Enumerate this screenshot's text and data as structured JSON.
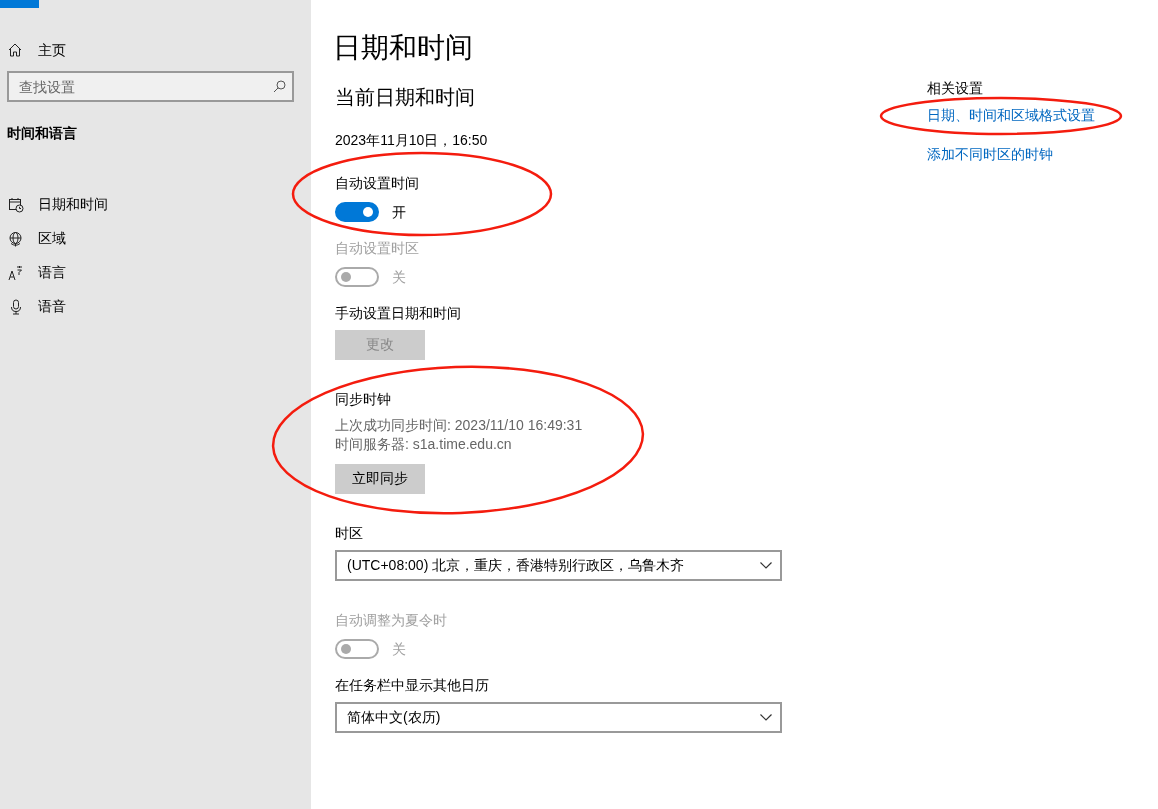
{
  "sidebar": {
    "home": "主页",
    "search": {
      "placeholder": "查找设置"
    },
    "section_title": "时间和语言",
    "items": [
      {
        "label": "日期和时间"
      },
      {
        "label": "区域"
      },
      {
        "label": "语言"
      },
      {
        "label": "语音"
      }
    ]
  },
  "page": {
    "title": "日期和时间",
    "section_heading": "当前日期和时间",
    "current_datetime": "2023年11月10日，16:50",
    "settings": [
      {
        "kind": "toggle",
        "label": "自动设置时间",
        "on": true,
        "state_text": "开",
        "disabled": false
      },
      {
        "kind": "toggle",
        "label": "自动设置时区",
        "on": false,
        "state_text": "关",
        "disabled": true
      },
      {
        "kind": "button",
        "label": "手动设置日期和时间",
        "button": "更改",
        "disabled": true
      },
      {
        "kind": "sync",
        "label": "同步时钟",
        "lines": [
          "上次成功同步时间: 2023/11/10 16:49:31",
          "时间服务器: s1a.time.edu.cn"
        ],
        "button": "立即同步",
        "disabled": false
      },
      {
        "kind": "dropdown",
        "label": "时区",
        "value": "(UTC+08:00) 北京，重庆，香港特别行政区，乌鲁木齐"
      },
      {
        "kind": "toggle",
        "label": "自动调整为夏令时",
        "on": false,
        "state_text": "关",
        "disabled": true
      },
      {
        "kind": "dropdown",
        "label": "在任务栏中显示其他日历",
        "value": "简体中文(农历)"
      }
    ]
  },
  "related": {
    "title": "相关设置",
    "links": [
      "日期、时间和区域格式设置",
      "添加不同时区的时钟"
    ]
  }
}
